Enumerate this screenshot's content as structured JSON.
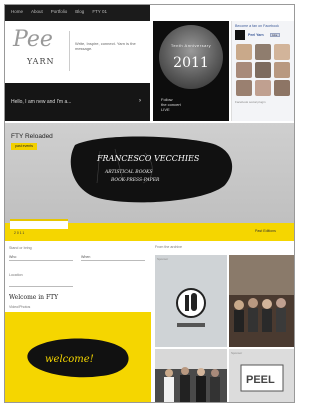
{
  "nav": {
    "items": [
      "Home",
      "About",
      "Portfolio",
      "Blog",
      "FTY 01"
    ]
  },
  "header": {
    "logo_script": "Pee",
    "logo_word": "YARN",
    "tagline": "Write, Inspire, connect. Yarn is the message.",
    "hello": "Hello, I am new and I'm a..."
  },
  "anniversary": {
    "label": "Tenth Anniversary",
    "year": "2011",
    "caption_line1": "Follow",
    "caption_line2": "the concert",
    "caption_line3": "LIVE"
  },
  "facebook": {
    "header": "Become a fan on Facebook",
    "page_name": "Peel Yarn",
    "like_label": "Like",
    "footer": "Facebook social plugin",
    "faces": [
      "#c9a98a",
      "#8f7d6e",
      "#d2b49a",
      "#a88a7a",
      "#7d6b5e",
      "#b89880",
      "#9a8070",
      "#c0a090",
      "#8d7565"
    ]
  },
  "banner": {
    "title": "FTY Reloaded",
    "button_label": "past events",
    "signature": "FRANCESCO VECCHIES",
    "subline1": "ARTISTICAL BOOKS",
    "subline2": "BOOK-PRESS-PAPER",
    "tab_label": "2011",
    "past_editions": "Past Editions"
  },
  "sidebar": {
    "register_label": "Stand or bring",
    "select_one": "Who",
    "select_two": "When",
    "location_label": "Location",
    "location_value": "",
    "welcome_title": "Welcome in FTY",
    "video_label": "Video/Photos",
    "welcome_script": "welcome!"
  },
  "gallery": {
    "label": "From the archive",
    "tile1_label": "Sponsor",
    "tile2_label": "Partner",
    "tile3_label": "Event",
    "tile4_label": "Sponsor",
    "logo_text": "PEEL"
  },
  "colors": {
    "accent_yellow": "#f5d600",
    "dark": "#151515",
    "fb_blue": "#3b5998"
  }
}
